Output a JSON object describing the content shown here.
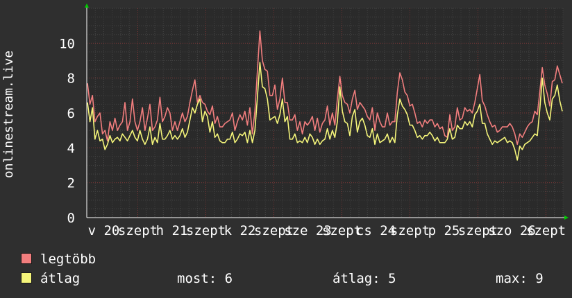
{
  "ylabel": "onlinestream.live",
  "legend": {
    "max_label": "legtöbb",
    "avg_label": "átlag",
    "max_color": "#f27e7e",
    "avg_color": "#f5f57a"
  },
  "stats": {
    "current": "most: 6",
    "average": "átlag: 5",
    "maximum": "max: 9"
  },
  "chart_data": {
    "type": "line",
    "ylim": [
      0,
      12
    ],
    "yticks": [
      0,
      2,
      4,
      6,
      8,
      10
    ],
    "grid": true,
    "xtick_labels": [
      "v 20",
      "szept",
      "h 21",
      "szept",
      "k 22",
      "szept",
      "sze 23",
      "szept",
      "cs 24",
      "szept",
      "p 25",
      "szept",
      "szo 26",
      "szept"
    ],
    "series": [
      {
        "name": "legtöbb",
        "color": "#f27e7e",
        "values": [
          7.7,
          6.5,
          7,
          5.5,
          5.8,
          6,
          4.8,
          5,
          4.4,
          5.5,
          5,
          5.7,
          5,
          5.3,
          5.5,
          6.6,
          5,
          5.5,
          6.8,
          5.5,
          5,
          5.5,
          6.3,
          5,
          5.7,
          6.5,
          5,
          5.2,
          5.6,
          6.9,
          5.5,
          5.8,
          6.3,
          6,
          5,
          5.5,
          5,
          5.5,
          6,
          5.5,
          5.8,
          6.6,
          7.3,
          7.9,
          6.6,
          7,
          6.6,
          6.5,
          6.1,
          5.9,
          6.4,
          5.4,
          5.8,
          5.2,
          5.2,
          5.4,
          5.5,
          5.6,
          6,
          5,
          5.5,
          5.9,
          5.6,
          6.1,
          5.3,
          6.3,
          4.8,
          6.1,
          8.4,
          10.7,
          9,
          8.5,
          8.4,
          7,
          7,
          7.6,
          6.2,
          6.8,
          8,
          6.6,
          6.6,
          5.6,
          5.6,
          5.9,
          5,
          5.5,
          4.8,
          5.5,
          5.3,
          5.5,
          5.8,
          5,
          5.7,
          4.9,
          5.4,
          5.6,
          6.4,
          5.3,
          6,
          5.3,
          6.8,
          8.1,
          7,
          6.6,
          6.5,
          6,
          6.8,
          7.3,
          6.2,
          6.6,
          6.4,
          6.2,
          5.8,
          5.6,
          6.3,
          5,
          6,
          5.5,
          5.2,
          5.2,
          6,
          5.3,
          5.5,
          5.5,
          7.2,
          8.3,
          7.9,
          7.2,
          7,
          6.4,
          6.5,
          6,
          5.4,
          5.5,
          5.2,
          5.6,
          5.4,
          5.6,
          5.6,
          5.2,
          5.4,
          5.1,
          5.2,
          4.7,
          4.6,
          5.9,
          5,
          5.2,
          6.3,
          5.6,
          5.7,
          6.3,
          6.1,
          6.2,
          6,
          6.6,
          7.4,
          8.2,
          6.7,
          6.4,
          5.9,
          5.5,
          5.2,
          5.3,
          4.9,
          5,
          5.2,
          5.2,
          5.2,
          5.4,
          5.2,
          4.8,
          4.2,
          4.8,
          4.6,
          4.9,
          5.2,
          5.4,
          5.5,
          6.1,
          5.9,
          7.2,
          8.6,
          7.6,
          7.1,
          6.4,
          7.8,
          7.9,
          8.7,
          8.2,
          7.7
        ]
      },
      {
        "name": "átlag",
        "color": "#f5f57a",
        "values": [
          6.6,
          5.5,
          6.3,
          4.5,
          5,
          4.4,
          4.5,
          3.9,
          4.2,
          4.7,
          4.3,
          4.5,
          4.6,
          4.4,
          4.8,
          4.6,
          4.4,
          4.7,
          5,
          4.6,
          4.4,
          5,
          4.5,
          4.2,
          4.5,
          5.2,
          4.2,
          4.6,
          4.3,
          5.4,
          4.5,
          4.5,
          4.7,
          5,
          4.5,
          4.7,
          4.5,
          4.7,
          5.1,
          4.6,
          4.9,
          5.6,
          6.3,
          6,
          6.5,
          6.8,
          5.5,
          6.1,
          5.8,
          4.9,
          5.5,
          4.6,
          4.8,
          4.4,
          4.3,
          4.3,
          4.5,
          4.5,
          4.9,
          4.3,
          4.5,
          4.8,
          4.7,
          4.9,
          4.3,
          5,
          4.3,
          5,
          6.9,
          8.9,
          7.5,
          7.4,
          6.8,
          5.6,
          5.7,
          5.8,
          5.4,
          5.9,
          6.8,
          5.5,
          5.8,
          4.5,
          4.5,
          4.8,
          4.3,
          4.4,
          4.3,
          4.6,
          4.3,
          4.8,
          4.6,
          4.2,
          4.5,
          4.2,
          4.4,
          4.5,
          5.1,
          4.5,
          5,
          4.6,
          5.5,
          7.5,
          6.1,
          5.5,
          5.4,
          4.7,
          5.8,
          6.2,
          4.9,
          5.5,
          5.7,
          5.3,
          4.7,
          4.6,
          5.1,
          4.2,
          4.8,
          4.3,
          4.4,
          4.5,
          4.8,
          4.3,
          4.6,
          4.3,
          5.9,
          6.8,
          6.4,
          6.2,
          5.9,
          5.3,
          5.3,
          5,
          4.6,
          4.7,
          4.5,
          4.7,
          4.7,
          4.9,
          4.7,
          4.4,
          4.6,
          4.3,
          4.3,
          4.3,
          4.5,
          5.1,
          4.5,
          4.6,
          5.3,
          5.1,
          5.1,
          5.5,
          5.3,
          5.5,
          5.2,
          5.9,
          6.1,
          6.5,
          5.4,
          5.4,
          4.8,
          4.5,
          4.2,
          4.4,
          4.3,
          4.4,
          4.5,
          4.6,
          4.3,
          4.4,
          4.3,
          3.9,
          3.3,
          4.1,
          3.9,
          4.2,
          4.3,
          4.4,
          4.6,
          4.8,
          4.7,
          6.2,
          8,
          6.6,
          6,
          5.6,
          6.8,
          7,
          7.6,
          6.7,
          6.1
        ]
      }
    ]
  }
}
